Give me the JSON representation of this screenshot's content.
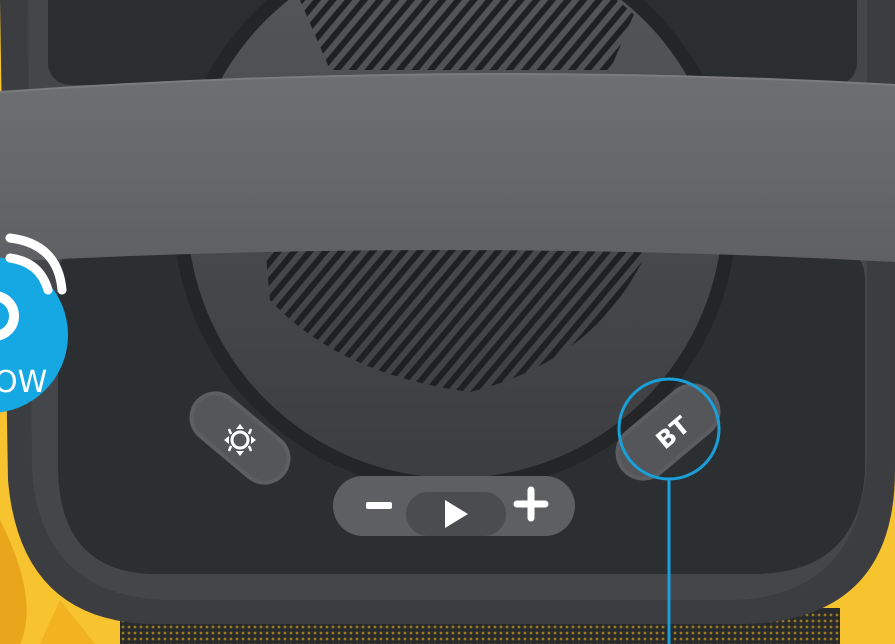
{
  "badge": {
    "text": "OW",
    "color": "#15a8e2"
  },
  "controls": {
    "light_button": {
      "icon": "light-mode-icon"
    },
    "volume_down": {
      "icon": "minus-icon"
    },
    "play_button": {
      "icon": "play-icon"
    },
    "volume_up": {
      "icon": "plus-icon"
    },
    "bluetooth_button": {
      "label": "BT"
    }
  },
  "colors": {
    "background": "#f7c32e",
    "speaker_body": "#3a3c3f",
    "strap": "#6a6b6e",
    "callout": "#1a9fd9"
  }
}
